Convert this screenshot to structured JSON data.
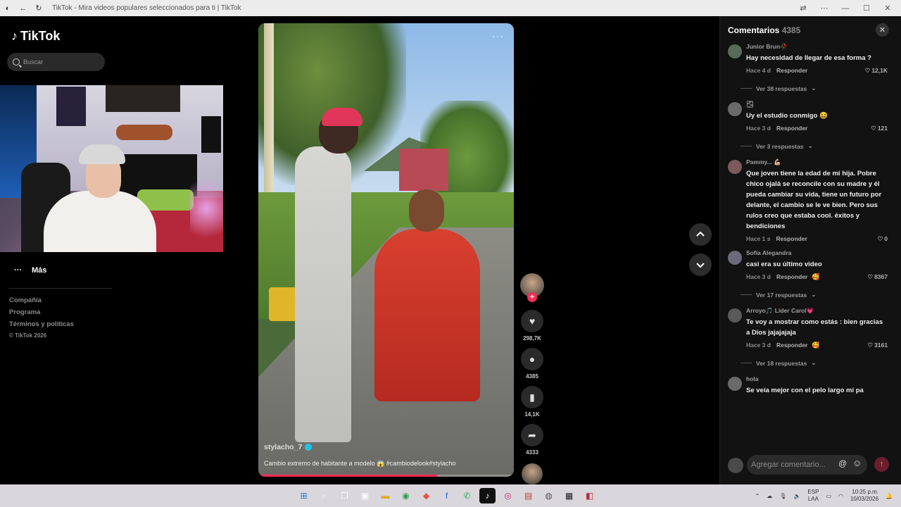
{
  "browser": {
    "title": "TikTok - Mira videos populares seleccionados para ti | TikTok"
  },
  "sidebar": {
    "logo_text": "TikTok",
    "search_placeholder": "Buscar",
    "more_label": "Más",
    "footer": [
      "Compañía",
      "Programa",
      "Términos y políticas",
      "© TikTok 2026"
    ]
  },
  "video": {
    "author": "stylacho_7",
    "caption": "Cambio extremo de habitante a modelo 😱 #cambiodelook#stylacho",
    "progress": 0.7
  },
  "actions": {
    "likes": "298,7K",
    "comments": "4385",
    "saves": "14,1K",
    "shares": "4333"
  },
  "comments_panel": {
    "title": "Comentarios",
    "count": "4385",
    "input_placeholder": "Agregar comentario...",
    "items": [
      {
        "user": "Junior Brun🥀",
        "text": "Hay necesidad de llegar de esa forma ?",
        "time": "Hace 4 d",
        "reply": "Responder",
        "likes": "12,1K",
        "replies": "Ver 38 respuestas",
        "avatar_color": "#5a6a5a"
      },
      {
        "user": "🌫",
        "text": "Uy el estudio conmigo 😆",
        "time": "Hace 3 d",
        "reply": "Responder",
        "likes": "121",
        "replies": "Ver 3 respuestas",
        "avatar_color": "#6a6a6a"
      },
      {
        "user": "Pammy... 💪🏼",
        "text": "Que joven tiene la edad de mí hija. Pobre chico ojalá se reconcile con su madre y él pueda cambiar su vida, tiene un futuro por delante, el cambio se le ve bien. Pero sus rulos creo que estaba cool. éxitos y bendiciones",
        "time": "Hace 1 s",
        "reply": "Responder",
        "likes": "0",
        "replies": "",
        "avatar_color": "#7a5a5a"
      },
      {
        "user": "Sofía Alegandra",
        "text": "casi era su último video",
        "time": "Hace 3 d",
        "reply": "Responder",
        "likes": "8367",
        "replies": "Ver 17 respuestas",
        "avatar_color": "#6a6a7a",
        "creator_liked": true
      },
      {
        "user": "Arroyo🎵 Líder Carol💗",
        "text": "Te voy a mostrar como estás : bien gracias a Dios jajajajaja",
        "time": "Hace 3 d",
        "reply": "Responder",
        "likes": "3161",
        "replies": "Ver 18 respuestas",
        "avatar_color": "#5a5a5a",
        "creator_liked": true
      },
      {
        "user": "hola",
        "text": "Se veía mejor con el pelo largo mi pa",
        "time": "",
        "reply": "",
        "likes": "",
        "replies": "",
        "avatar_color": "#6a6a6a"
      }
    ]
  },
  "taskbar": {
    "lang": "ESP",
    "lang2": "LAA",
    "time": "10:25 p.m.",
    "date": "10/03/2026"
  }
}
